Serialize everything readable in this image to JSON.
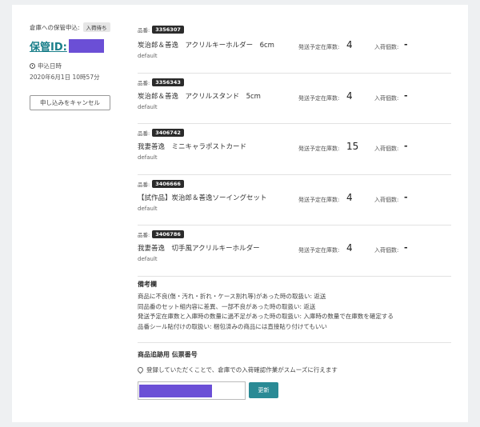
{
  "request": {
    "kind_label": "倉庫への保管申込:",
    "status": "入荷待ち",
    "storage_id_label": "保管ID:",
    "date_label": "申込日時",
    "date_value": "2020年6月1日 10時57分",
    "cancel_label": "申し込みをキャンセル"
  },
  "item_labels": {
    "hinban": "品番:",
    "ship": "発送予定在庫数:",
    "recv": "入荷個数:"
  },
  "items": [
    {
      "code": "3356307",
      "name": "炭治郎＆善逸　アクリルキーホルダー　6cm",
      "variant": "default",
      "ship": "4",
      "recv": "-"
    },
    {
      "code": "3356343",
      "name": "炭治郎＆善逸　アクリルスタンド　5cm",
      "variant": "default",
      "ship": "4",
      "recv": "-"
    },
    {
      "code": "3406742",
      "name": "我妻善逸　ミニキャラポストカード",
      "variant": "default",
      "ship": "15",
      "recv": "-"
    },
    {
      "code": "3406666",
      "name": "【試作品】炭治郎＆善逸ソーイングセット",
      "variant": "default",
      "ship": "4",
      "recv": "-"
    },
    {
      "code": "3406786",
      "name": "我妻善逸　切手風アクリルキーホルダー",
      "variant": "default",
      "ship": "4",
      "recv": "-"
    }
  ],
  "notes": {
    "title": "備考欄",
    "lines": [
      "商品に不良(傷・汚れ・折れ・ケース割れ等)があった時の取扱い: 返送",
      "同品番のセット組内容に差異、一部不良があった時の取扱い: 返送",
      "発送予定在庫数と入庫時の数量に過不足があった時の取扱い: 入庫時の数量で在庫数を確定する",
      "品番シール貼付けの取扱い: 梱包済みの商品には直接貼り付けてもいい"
    ]
  },
  "tracking": {
    "title": "商品追跡用 伝票番号",
    "hint": "登録していただくことで、倉庫での入荷確認作業がスムーズに行えます",
    "update_label": "更新"
  }
}
